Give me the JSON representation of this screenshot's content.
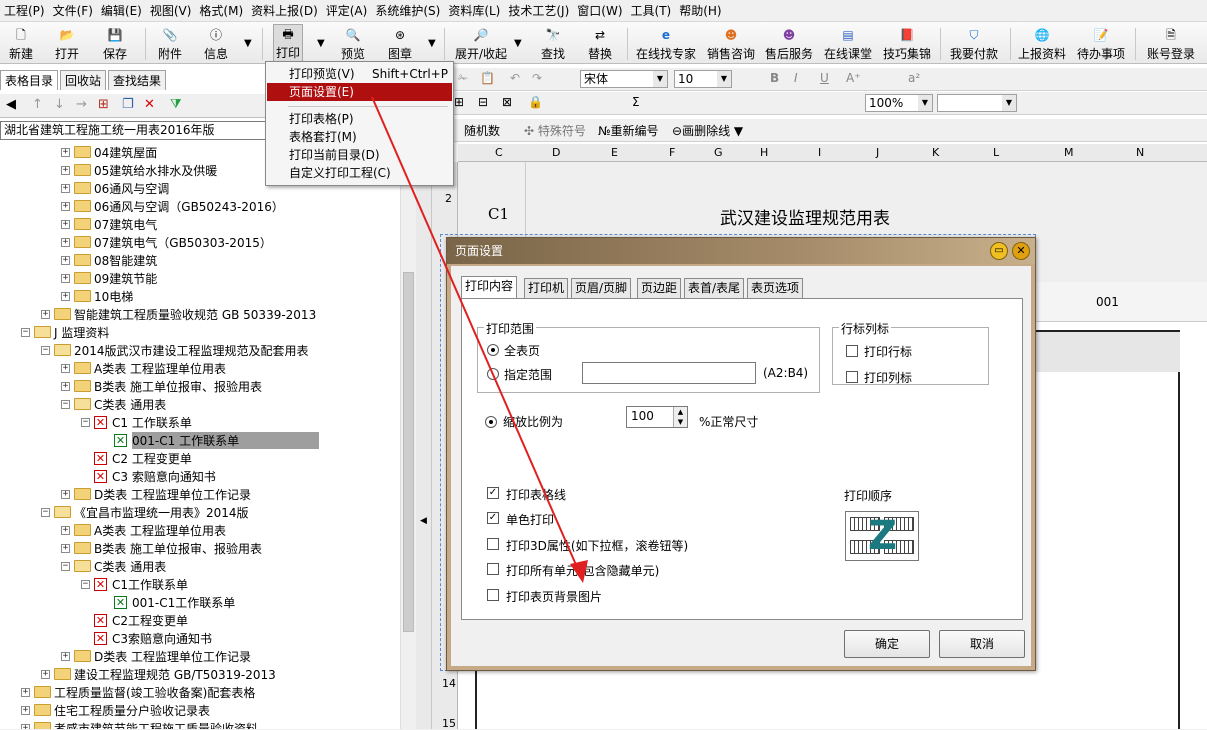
{
  "menubar": [
    "工程(P)",
    "文件(F)",
    "编辑(E)",
    "视图(V)",
    "格式(M)",
    "资料上报(D)",
    "评定(A)",
    "系统维护(S)",
    "资料库(L)",
    "技术工艺(J)",
    "窗口(W)",
    "工具(T)",
    "帮助(H)"
  ],
  "toolbar": {
    "new": "新建",
    "open": "打开",
    "save": "保存",
    "attach": "附件",
    "info": "信息",
    "print": "打印",
    "preview": "预览",
    "stamp": "图章",
    "expand": "展开/收起",
    "find": "查找",
    "replace": "替换",
    "expert": "在线找专家",
    "sales": "销售咨询",
    "after_sales": "售后服务",
    "classroom": "在线课堂",
    "tips": "技巧集锦",
    "pay": "我要付款",
    "upload": "上报资料",
    "todo": "待办事项",
    "login": "账号登录"
  },
  "left_tabs": [
    "表格目录",
    "回收站",
    "查找结果"
  ],
  "combo_value": "湖北省建筑工程施工统一用表2016年版",
  "tree": [
    {
      "text": "04建筑屋面"
    },
    {
      "text": "05建筑给水排水及供暖"
    },
    {
      "text": "06通风与空调"
    },
    {
      "text": "06通风与空调（GB50243-2016）"
    },
    {
      "text": "07建筑电气"
    },
    {
      "text": "07建筑电气（GB50303-2015）"
    },
    {
      "text": "08智能建筑"
    },
    {
      "text": "09建筑节能"
    },
    {
      "text": "10电梯"
    },
    {
      "text": "智能建筑工程质量验收规范 GB 50339-2013"
    },
    {
      "text": "J 监理资料"
    },
    {
      "text": "2014版武汉市建设工程监理规范及配套用表"
    },
    {
      "text": "A类表 工程监理单位用表"
    },
    {
      "text": "B类表 施工单位报审、报验用表"
    },
    {
      "text": "C类表 通用表"
    },
    {
      "text": "C1 工作联系单"
    },
    {
      "text": "001-C1 工作联系单"
    },
    {
      "text": "C2 工程变更单"
    },
    {
      "text": "C3 索赔意向通知书"
    },
    {
      "text": "D类表 工程监理单位工作记录"
    },
    {
      "text": "《宜昌市监理统一用表》2014版"
    },
    {
      "text": "A类表 工程监理单位用表"
    },
    {
      "text": "B类表 施工单位报审、报验用表"
    },
    {
      "text": "C类表 通用表"
    },
    {
      "text": "C1工作联系单"
    },
    {
      "text": "001-C1工作联系单"
    },
    {
      "text": "C2工程变更单"
    },
    {
      "text": "C3索赔意向通知书"
    },
    {
      "text": "D类表 工程监理单位工作记录"
    },
    {
      "text": "建设工程监理规范 GB/T50319-2013"
    },
    {
      "text": "工程质量监督(竣工验收备案)配套表格"
    },
    {
      "text": "住宅工程质量分户验收记录表"
    },
    {
      "text": "孝感市建筑节能工程施工质量验收资料"
    }
  ],
  "right_toolbar": {
    "font": "宋体",
    "size": "10",
    "zoom": "100%",
    "random": "随机数",
    "special": "特殊符号",
    "renumber": "重新编号",
    "strike": "画删除线"
  },
  "columns": [
    "C",
    "D",
    "E",
    "F",
    "G",
    "H",
    "I",
    "J",
    "K",
    "L",
    "M",
    "N"
  ],
  "rows": [
    "2",
    "14",
    "15"
  ],
  "sheet": {
    "code": "C1",
    "title": "武汉建设监理规范用表",
    "number": "001"
  },
  "print_menu": {
    "items": [
      {
        "label": "打印预览(V)",
        "shortcut": "Shift+Ctrl+P"
      },
      {
        "label": "页面设置(E)",
        "shortcut": ""
      },
      {
        "label": "打印表格(P)",
        "shortcut": ""
      },
      {
        "label": "表格套打(M)",
        "shortcut": ""
      },
      {
        "label": "打印当前目录(D)",
        "shortcut": ""
      },
      {
        "label": "自定义打印工程(C)",
        "shortcut": ""
      }
    ]
  },
  "dialog": {
    "title": "页面设置",
    "tabs": [
      "打印内容",
      "打印机",
      "页眉/页脚",
      "页边距",
      "表首/表尾",
      "表页选项"
    ],
    "print_range_label": "打印范围",
    "all_pages": "全表页",
    "range_label": "指定范围",
    "range_value": "",
    "range_hint": "(A2:B4)",
    "scale_label": "缩放比例为",
    "scale_value": "100",
    "scale_unit": "%正常尺寸",
    "row_col_label": "行标列标",
    "print_row": "打印行标",
    "print_col": "打印列标",
    "opt_gridlines": "打印表格线",
    "opt_mono": "单色打印",
    "opt_3d": "打印3D属性(如下拉框，滚卷钮等)",
    "opt_all_cells": "打印所有单元(包含隐藏单元)",
    "opt_bg": "打印表页背景图片",
    "print_order": "打印顺序",
    "ok": "确定",
    "cancel": "取消",
    "scale_checked": true,
    "gridlines_checked": true,
    "mono_checked": true
  },
  "colors": {
    "accent": "#b00f0f",
    "dialog_frame": "#c6a986",
    "arrow": "#e02020"
  }
}
